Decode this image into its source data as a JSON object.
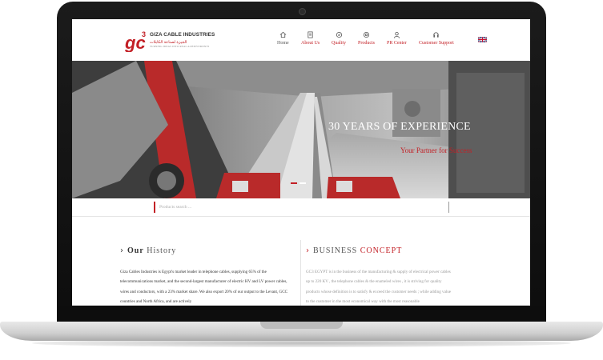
{
  "header": {
    "logo_text": "GIZA CABLE INDUSTRIES",
    "logo_arabic": "الجيزة لصناعة الكابلات",
    "logo_tagline": "TURNING IDEAS INTO REAL ACHIEVEMENTS"
  },
  "nav": [
    {
      "label": "Home",
      "icon": "home-icon"
    },
    {
      "label": "About Us",
      "icon": "about-icon"
    },
    {
      "label": "Quality",
      "icon": "quality-icon"
    },
    {
      "label": "Products",
      "icon": "products-icon"
    },
    {
      "label": "PR Center",
      "icon": "pr-center-icon"
    },
    {
      "label": "Customer Support",
      "icon": "customer-support-icon"
    }
  ],
  "language_flag": "uk-flag-icon",
  "hero": {
    "title": "30 YEARS OF EXPERIENCE",
    "subtitle": "Your Partner for Success"
  },
  "search": {
    "placeholder": "Products search ..."
  },
  "history": {
    "heading_prefix": "Our",
    "heading_rest": "History",
    "text": "Giza Cables Industries is Egypt's market leader in telephone cables, supplying 65% of the telecommunications market, and the second-largest manufacturer of electric HV and LV power cables, wires and conductors, with a 23% market share. We also export 20% of our output to the Levant, GCC countries and North Africa, and are actively"
  },
  "concept": {
    "heading_prefix": "BUSINESS",
    "heading_accent": "CONCEPT",
    "text": "GC3 EGYPT is in the business of the manufacturing & supply of electrical power cables up to 220 KV , the telephone cables & the enameled wires , it is striving for quality products whose definition is to satisfy & exceed the customer needs ; while adding value to the customer in the most economical way with the most reasonable"
  },
  "colors": {
    "brand_red": "#c32026",
    "text_dark": "#333333"
  }
}
